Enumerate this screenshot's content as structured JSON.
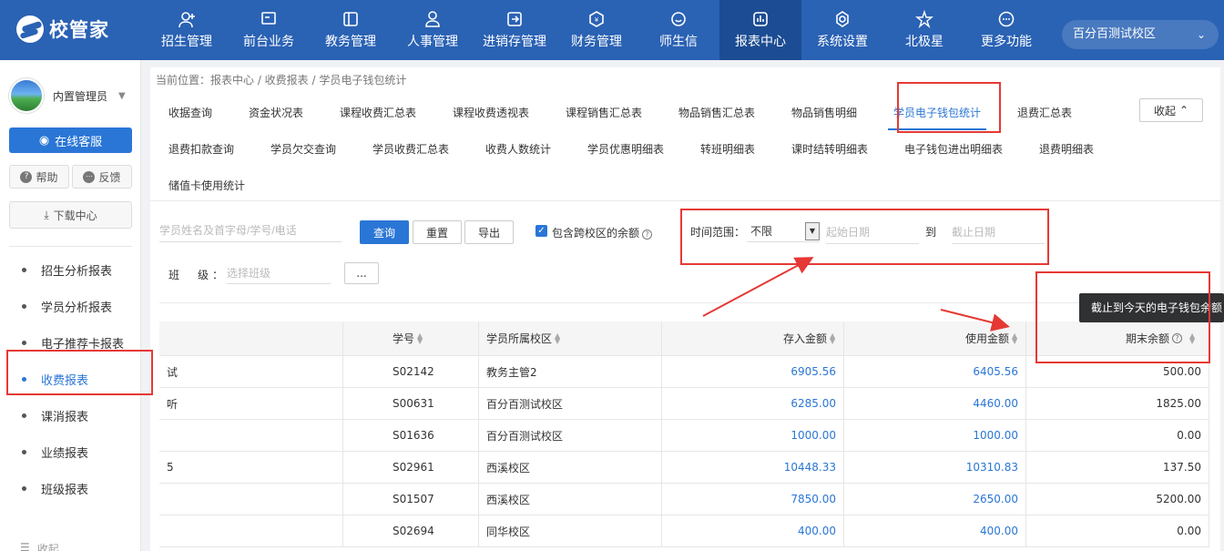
{
  "app": {
    "logo_text": "校管家"
  },
  "nav": {
    "items": [
      {
        "label": "招生管理",
        "icon": "user-plus-icon"
      },
      {
        "label": "前台业务",
        "icon": "monitor-icon"
      },
      {
        "label": "教务管理",
        "icon": "book-icon"
      },
      {
        "label": "人事管理",
        "icon": "person-icon"
      },
      {
        "label": "进销存管理",
        "icon": "box-arrow-icon"
      },
      {
        "label": "财务管理",
        "icon": "money-icon"
      },
      {
        "label": "师生信",
        "icon": "chat-icon"
      },
      {
        "label": "报表中心",
        "icon": "chart-icon",
        "active": true
      },
      {
        "label": "系统设置",
        "icon": "gear-icon"
      },
      {
        "label": "北极星",
        "icon": "star-icon"
      },
      {
        "label": "更多功能",
        "icon": "more-icon"
      }
    ],
    "campus": "百分百测试校区"
  },
  "sidebar": {
    "user_name": "内置管理员",
    "service_label": "在线客服",
    "help_label": "帮助",
    "feedback_label": "反馈",
    "download_label": "下载中心",
    "menu": [
      {
        "label": "招生分析报表"
      },
      {
        "label": "学员分析报表"
      },
      {
        "label": "电子推荐卡报表"
      },
      {
        "label": "收费报表",
        "active": true
      },
      {
        "label": "课消报表"
      },
      {
        "label": "业绩报表"
      },
      {
        "label": "班级报表"
      }
    ],
    "collapse_label": "收起"
  },
  "breadcrumb": "当前位置：报表中心 / 收费报表 / 学员电子钱包统计",
  "tabs": {
    "row1": [
      "收据查询",
      "资金状况表",
      "课程收费汇总表",
      "课程收费透视表",
      "课程销售汇总表",
      "物品销售汇总表",
      "物品销售明细",
      "学员电子钱包统计",
      "退费汇总表"
    ],
    "row2": [
      "退费扣款查询",
      "学员欠交查询",
      "学员收费汇总表",
      "收费人数统计",
      "学员优惠明细表",
      "转班明细表",
      "课时结转明细表",
      "电子钱包进出明细表",
      "退费明细表"
    ],
    "row3": [
      "储值卡使用统计"
    ],
    "collapse_label": "收起"
  },
  "filters": {
    "search_placeholder": "学员姓名及首字母/学号/电话",
    "query_label": "查询",
    "reset_label": "重置",
    "export_label": "导出",
    "cross_campus_label": "包含跨校区的余额",
    "time_range_label": "时间范围：",
    "time_range_value": "不限",
    "start_placeholder": "起始日期",
    "to_label": "到",
    "end_placeholder": "截止日期",
    "class_label": "班　级：",
    "class_placeholder": "选择班级",
    "more_label": "..."
  },
  "table": {
    "headers": {
      "no": "学号",
      "campus": "学员所属校区",
      "deposit": "存入金额",
      "used": "使用金额",
      "balance": "期末余额"
    },
    "rows": [
      {
        "name": "试",
        "no": "S02142",
        "campus": "教务主管2",
        "deposit": "6905.56",
        "used": "6405.56",
        "balance": "500.00"
      },
      {
        "name": "听",
        "no": "S00631",
        "campus": "百分百测试校区",
        "deposit": "6285.00",
        "used": "4460.00",
        "balance": "1825.00"
      },
      {
        "name": "",
        "no": "S01636",
        "campus": "百分百测试校区",
        "deposit": "1000.00",
        "used": "1000.00",
        "balance": "0.00"
      },
      {
        "name": "5",
        "no": "S02961",
        "campus": "西溪校区",
        "deposit": "10448.33",
        "used": "10310.83",
        "balance": "137.50"
      },
      {
        "name": "",
        "no": "S01507",
        "campus": "西溪校区",
        "deposit": "7850.00",
        "used": "2650.00",
        "balance": "5200.00"
      },
      {
        "name": "",
        "no": "S02694",
        "campus": "同华校区",
        "deposit": "400.00",
        "used": "400.00",
        "balance": "0.00"
      }
    ]
  },
  "tooltip": "截止到今天的电子钱包余额",
  "colors": {
    "nav_bg": "#2a62b4",
    "accent": "#2a76d6",
    "annotation": "#e53935"
  }
}
